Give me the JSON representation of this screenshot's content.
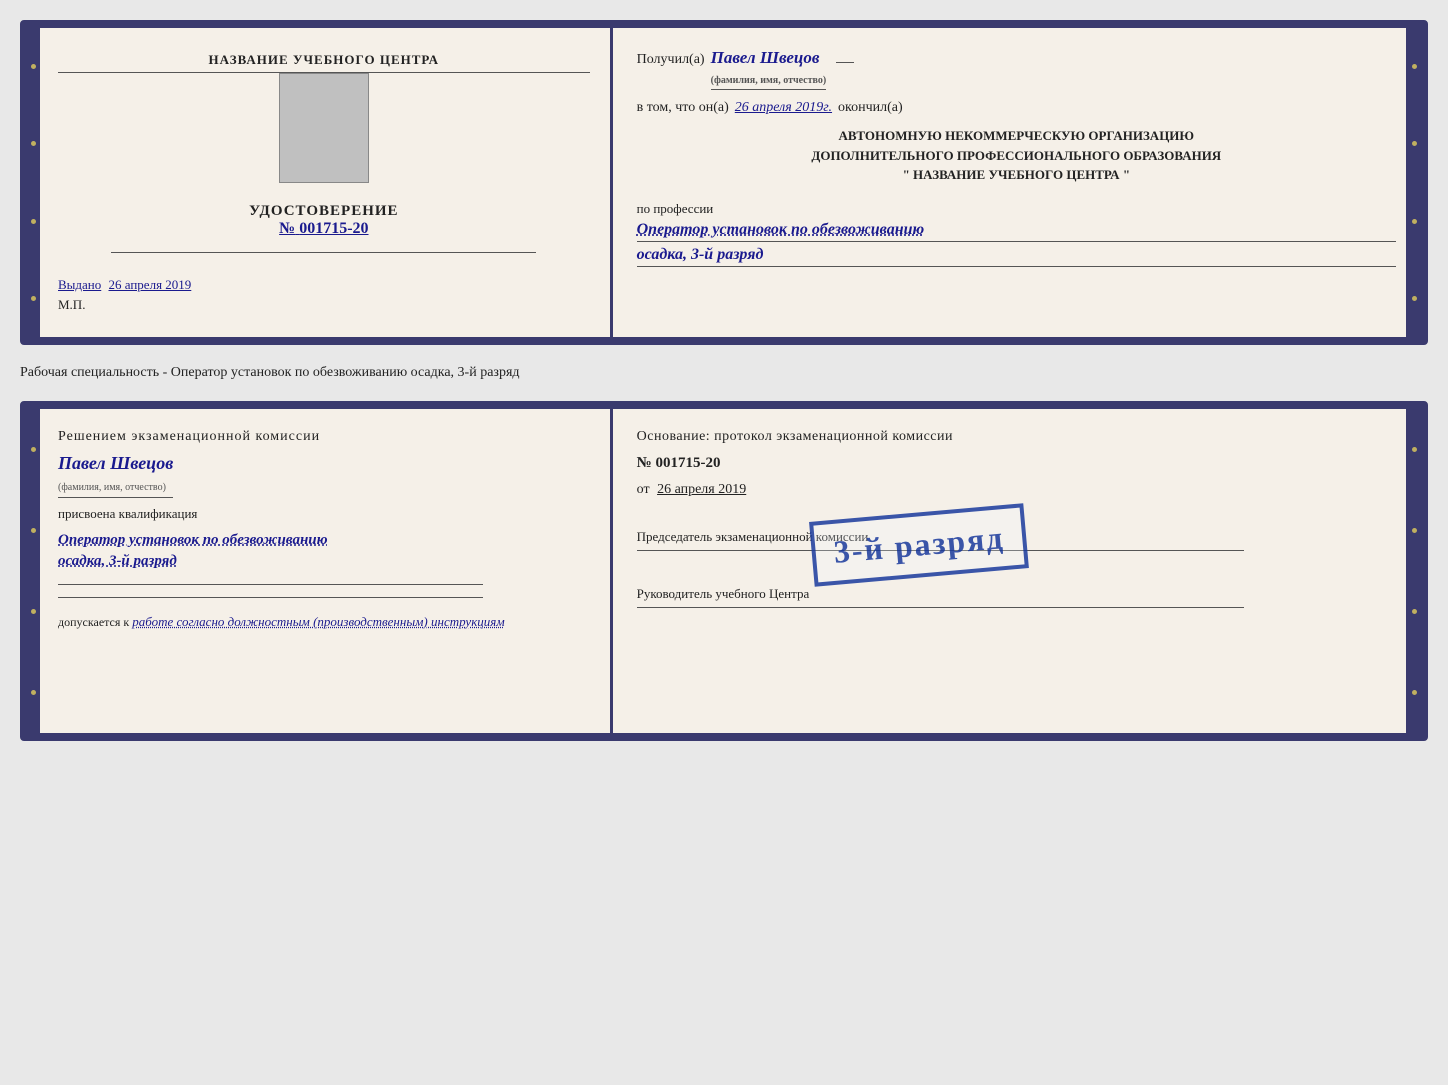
{
  "top_cert": {
    "left": {
      "org_name": "НАЗВАНИЕ УЧЕБНОГО ЦЕНТРА",
      "title": "УДОСТОВЕРЕНИЕ",
      "number_prefix": "№",
      "number": "001715-20",
      "issued_label": "Выдано",
      "issued_date": "26 апреля 2019",
      "mp_label": "М.П."
    },
    "right": {
      "received_label": "Получил(а)",
      "recipient_name": "Павел Швецов",
      "recipient_sub": "(фамилия, имя, отчество)",
      "vtom_label": "в том, что он(а)",
      "vtom_date": "26 апреля 2019г.",
      "okonchil_label": "окончил(а)",
      "org_line1": "АВТОНОМНУЮ НЕКОММЕРЧЕСКУЮ ОРГАНИЗАЦИЮ",
      "org_line2": "ДОПОЛНИТЕЛЬНОГО ПРОФЕССИОНАЛЬНОГО ОБРАЗОВАНИЯ",
      "org_line3": "\"   НАЗВАНИЕ УЧЕБНОГО ЦЕНТРА   \"",
      "po_professii_label": "по профессии",
      "profession": "Оператор установок по обезвоживанию",
      "specialty": "осадка, 3-й разряд"
    }
  },
  "info_line": {
    "text": "Рабочая специальность - Оператор установок по обезвоживанию осадка, 3-й разряд"
  },
  "bottom_cert": {
    "left": {
      "decision_text": "Решением экзаменационной комиссии",
      "person_name": "Павел Швецов",
      "person_sub": "(фамилия, имя, отчество)",
      "prisvoena_label": "присвоена квалификация",
      "qualification": "Оператор установок по обезвоживанию",
      "specialty": "осадка, 3-й разряд",
      "dopuskaetsya_label": "допускается к",
      "dopuskaetsya_value": "работе согласно должностным (производственным) инструкциям"
    },
    "right": {
      "osnov_label": "Основание: протокол экзаменационной комиссии",
      "number_prefix": "№",
      "number": "001715-20",
      "ot_prefix": "от",
      "ot_date": "26 апреля 2019",
      "predsedatel_label": "Председатель экзаменационной комиссии",
      "rukovoditel_label": "Руководитель учебного Центра"
    },
    "stamp": {
      "text": "3-й разряд"
    }
  }
}
